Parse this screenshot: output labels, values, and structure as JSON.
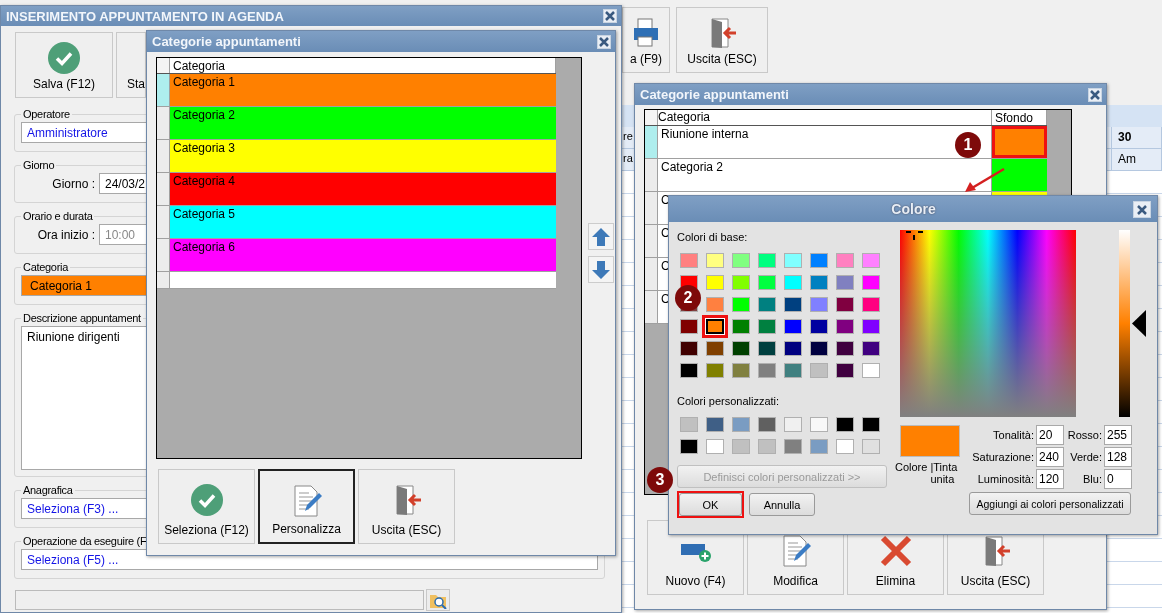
{
  "background_app": {
    "toolbar": [
      {
        "kind": "print",
        "label": "a (F9)"
      },
      {
        "kind": "exit",
        "label": "Uscita (ESC)"
      }
    ],
    "calendar": {
      "header": [
        "re",
        "30"
      ],
      "subheader": [
        "ra",
        "Am"
      ]
    }
  },
  "main_window": {
    "title": "INSERIMENTO APPUNTAMENTO IN AGENDA",
    "buttons": [
      {
        "kind": "save",
        "label": "Salva (F12)"
      },
      {
        "kind": "plain",
        "label": "Sta"
      }
    ],
    "groups": [
      {
        "kind": "field",
        "legend": "Operatore",
        "value": "Amministratore"
      },
      {
        "kind": "labeled",
        "legend": "Giorno",
        "label": "Giorno :",
        "value": "24/03/2",
        "disabled": false
      },
      {
        "kind": "labeled",
        "legend": "Orario e durata",
        "label": "Ora inizio :",
        "value": "10:00",
        "disabled": true
      },
      {
        "kind": "color",
        "legend": "Categoria",
        "value": "Categoria 1",
        "color": "#ff8000"
      },
      {
        "kind": "memo",
        "legend": "Descrizione appuntament",
        "value": "Riunione dirigenti"
      },
      {
        "kind": "field",
        "legend": "Anagrafica",
        "value": "Seleziona (F3) ..."
      },
      {
        "kind": "field",
        "legend": "Operazione da eseguire (F",
        "value": "Seleziona (F5) ..."
      }
    ]
  },
  "categories_dialog": {
    "title": "Categorie appuntamenti",
    "columns": [
      "Categoria"
    ],
    "rows": [
      {
        "name": "Categoria 1",
        "color": "#ff8000",
        "selected": true
      },
      {
        "name": "Categoria 2",
        "color": "#00ff00",
        "selected": false
      },
      {
        "name": "Categoria 3",
        "color": "#ffff00",
        "selected": false
      },
      {
        "name": "Categoria 4",
        "color": "#ff0000",
        "selected": false
      },
      {
        "name": "Categoria 5",
        "color": "#00ffff",
        "selected": false
      },
      {
        "name": "Categoria 6",
        "color": "#ff00ff",
        "selected": false
      }
    ],
    "buttons": [
      {
        "kind": "save",
        "label": "Seleziona (F12)",
        "focused": false
      },
      {
        "kind": "edit",
        "label": "Personalizza",
        "focused": true
      },
      {
        "kind": "exit",
        "label": "Uscita (ESC)",
        "focused": false
      }
    ]
  },
  "categories_editor": {
    "title": "Categorie appuntamenti",
    "columns": [
      "Categoria",
      "Sfondo"
    ],
    "rows": [
      {
        "name": "Riunione interna",
        "color": "#ff8000",
        "selected": true,
        "highlighted": true
      },
      {
        "name": "Categoria 2",
        "color": "#00ff00",
        "selected": false,
        "highlighted": false
      },
      {
        "name": "C",
        "color": "#ffff00",
        "selected": false,
        "highlighted": false
      },
      {
        "name": "C",
        "selected": false,
        "highlighted": false
      },
      {
        "name": "C",
        "selected": false,
        "highlighted": false
      },
      {
        "name": "C",
        "selected": false,
        "highlighted": false
      }
    ],
    "buttons": [
      {
        "kind": "new",
        "label": "Nuovo (F4)"
      },
      {
        "kind": "edit",
        "label": "Modifica"
      },
      {
        "kind": "delete",
        "label": "Elimina"
      },
      {
        "kind": "exit",
        "label": "Uscita (ESC)"
      }
    ]
  },
  "color_dialog": {
    "title": "Colore",
    "base_label": "Colori di base:",
    "base_colors": [
      {
        "color": "#ff8080",
        "selected": false,
        "highlighted": false
      },
      {
        "color": "#ffff80",
        "selected": false,
        "highlighted": false
      },
      {
        "color": "#80ff80",
        "selected": false,
        "highlighted": false
      },
      {
        "color": "#00ff80",
        "selected": false,
        "highlighted": false
      },
      {
        "color": "#80ffff",
        "selected": false,
        "highlighted": false
      },
      {
        "color": "#0080ff",
        "selected": false,
        "highlighted": false
      },
      {
        "color": "#ff80c0",
        "selected": false,
        "highlighted": false
      },
      {
        "color": "#ff80ff",
        "selected": false,
        "highlighted": false
      },
      {
        "color": "#ff0000",
        "selected": false,
        "highlighted": false
      },
      {
        "color": "#ffff00",
        "selected": false,
        "highlighted": false
      },
      {
        "color": "#80ff00",
        "selected": false,
        "highlighted": false
      },
      {
        "color": "#00ff40",
        "selected": false,
        "highlighted": false
      },
      {
        "color": "#00ffff",
        "selected": false,
        "highlighted": false
      },
      {
        "color": "#0080c0",
        "selected": false,
        "highlighted": false
      },
      {
        "color": "#8080c0",
        "selected": false,
        "highlighted": false
      },
      {
        "color": "#ff00ff",
        "selected": false,
        "highlighted": false
      },
      {
        "color": "#804040",
        "selected": false,
        "highlighted": false
      },
      {
        "color": "#ff8040",
        "selected": false,
        "highlighted": false
      },
      {
        "color": "#00ff00",
        "selected": false,
        "highlighted": false
      },
      {
        "color": "#008080",
        "selected": false,
        "highlighted": false
      },
      {
        "color": "#004080",
        "selected": false,
        "highlighted": false
      },
      {
        "color": "#8080ff",
        "selected": false,
        "highlighted": false
      },
      {
        "color": "#800040",
        "selected": false,
        "highlighted": false
      },
      {
        "color": "#ff0080",
        "selected": false,
        "highlighted": false
      },
      {
        "color": "#800000",
        "selected": false,
        "highlighted": false
      },
      {
        "color": "#ff8000",
        "selected": true,
        "highlighted": true
      },
      {
        "color": "#008000",
        "selected": false,
        "highlighted": false
      },
      {
        "color": "#008040",
        "selected": false,
        "highlighted": false
      },
      {
        "color": "#0000ff",
        "selected": false,
        "highlighted": false
      },
      {
        "color": "#0000a0",
        "selected": false,
        "highlighted": false
      },
      {
        "color": "#800080",
        "selected": false,
        "highlighted": false
      },
      {
        "color": "#8000ff",
        "selected": false,
        "highlighted": false
      },
      {
        "color": "#400000",
        "selected": false,
        "highlighted": false
      },
      {
        "color": "#804000",
        "selected": false,
        "highlighted": false
      },
      {
        "color": "#004000",
        "selected": false,
        "highlighted": false
      },
      {
        "color": "#004040",
        "selected": false,
        "highlighted": false
      },
      {
        "color": "#000080",
        "selected": false,
        "highlighted": false
      },
      {
        "color": "#000040",
        "selected": false,
        "highlighted": false
      },
      {
        "color": "#400040",
        "selected": false,
        "highlighted": false
      },
      {
        "color": "#400080",
        "selected": false,
        "highlighted": false
      },
      {
        "color": "#000000",
        "selected": false,
        "highlighted": false
      },
      {
        "color": "#808000",
        "selected": false,
        "highlighted": false
      },
      {
        "color": "#808040",
        "selected": false,
        "highlighted": false
      },
      {
        "color": "#808080",
        "selected": false,
        "highlighted": false
      },
      {
        "color": "#408080",
        "selected": false,
        "highlighted": false
      },
      {
        "color": "#c0c0c0",
        "selected": false,
        "highlighted": false
      },
      {
        "color": "#400040",
        "selected": false,
        "highlighted": false
      },
      {
        "color": "#ffffff",
        "selected": false,
        "highlighted": false
      }
    ],
    "custom_label": "Colori personalizzati:",
    "custom_colors": [
      {
        "color": "#c0c0c0",
        "selected": false
      },
      {
        "color": "#3f5f86",
        "selected": false
      },
      {
        "color": "#7a9cc2",
        "selected": false
      },
      {
        "color": "#606060",
        "selected": false
      },
      {
        "color": "#f0f0f0",
        "selected": false
      },
      {
        "color": "#f8f8f8",
        "selected": false
      },
      {
        "color": "#000000",
        "selected": false
      },
      {
        "color": "#000000",
        "selected": false
      },
      {
        "color": "#000000",
        "selected": false
      },
      {
        "color": "#ffffff",
        "selected": false
      },
      {
        "color": "#c0c0c0",
        "selected": false
      },
      {
        "color": "#c0c0c0",
        "selected": false
      },
      {
        "color": "#808080",
        "selected": false
      },
      {
        "color": "#7a9cc2",
        "selected": false
      },
      {
        "color": "#ffffff",
        "selected": false
      },
      {
        "color": "#e0e0e0",
        "selected": false
      }
    ],
    "define_button": {
      "label": "Definisci colori personalizzati >>",
      "disabled": true
    },
    "ok_button": {
      "label": "OK",
      "highlighted": true
    },
    "cancel_button": {
      "label": "Annulla"
    },
    "luminance": {
      "level": 0.5
    },
    "preview": {
      "color": "#ff8000",
      "label": "Colore",
      "solid_label": "|Tinta unita"
    },
    "fields": [
      {
        "label": "Tonalità:",
        "value": "20"
      },
      {
        "label": "Rosso:",
        "value": "255"
      },
      {
        "label": "Saturazione:",
        "value": "240"
      },
      {
        "label": "Verde:",
        "value": "128"
      },
      {
        "label": "Luminosità:",
        "value": "120"
      },
      {
        "label": "Blu:",
        "value": "0"
      }
    ],
    "add_button": {
      "label": "Aggiungi ai colori personalizzati"
    }
  },
  "callouts": [
    "1",
    "2",
    "3"
  ]
}
